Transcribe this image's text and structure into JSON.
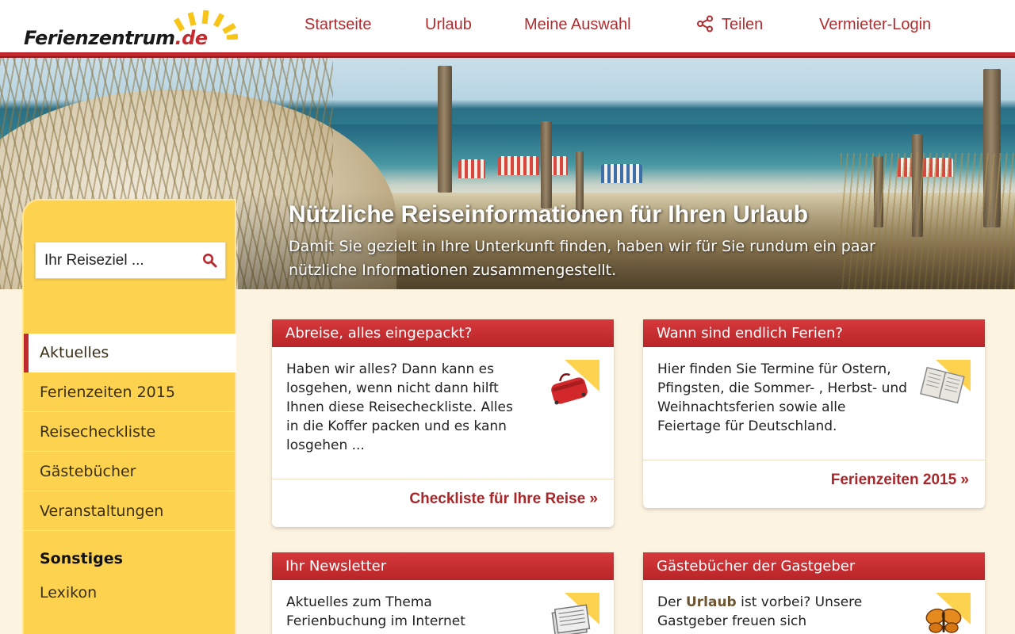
{
  "header": {
    "logo_text": "Ferienzentrum",
    "logo_tld": ".de",
    "nav": {
      "startseite": "Startseite",
      "urlaub": "Urlaub",
      "meine_auswahl": "Meine Auswahl",
      "teilen": "Teilen",
      "vermieter_login": "Vermieter-Login"
    }
  },
  "hero": {
    "title": "Nützliche Reiseinformationen für Ihren Urlaub",
    "subtitle": "Damit Sie gezielt in Ihre Unterkunft finden, haben wir für Sie rundum ein paar nützliche Informationen zusammengestellt."
  },
  "sidebar": {
    "search": {
      "placeholder": "Ihr Reiseziel ..."
    },
    "items": [
      {
        "label": "Aktuelles",
        "active": true
      },
      {
        "label": "Ferienzeiten 2015"
      },
      {
        "label": "Reisecheckliste"
      },
      {
        "label": "Gästebücher"
      },
      {
        "label": "Veranstaltungen"
      }
    ],
    "heading": "Sonstiges",
    "lexikon": "Lexikon"
  },
  "cards": {
    "abreise": {
      "title": "Abreise, alles eingepackt?",
      "text": "Haben wir alles? Dann kann es losgehen, wenn nicht dann hilft Ihnen diese Reisecheckliste. Alles in die Koffer packen und es kann losgehen ...",
      "link": "Checkliste für Ihre Reise »",
      "icon": "suitcase-icon"
    },
    "ferien": {
      "title": "Wann sind endlich Ferien?",
      "text": "Hier finden Sie Termine für Ostern, Pfingsten, die Sommer- , Herbst- und Weihnachtsferien sowie alle Feiertage für Deutschland.",
      "link": "Ferienzeiten 2015 »",
      "icon": "book-icon"
    },
    "newsletter": {
      "title": "Ihr Newsletter",
      "text": "Aktuelles zum Thema Ferienbuchung im Internet",
      "icon": "newspaper-icon"
    },
    "gaestebuch": {
      "title": "Gästebücher der Gastgeber",
      "text_pre": "Der ",
      "text_highlight": "Urlaub",
      "text_post": " ist vorbei? Unsere Gastgeber freuen sich",
      "icon": "butterfly-icon"
    }
  },
  "colors": {
    "brand_red": "#c0292d",
    "sidebar_yellow": "#fdd24f",
    "page_bg": "#fdf3e1",
    "link_red": "#a9272a"
  }
}
